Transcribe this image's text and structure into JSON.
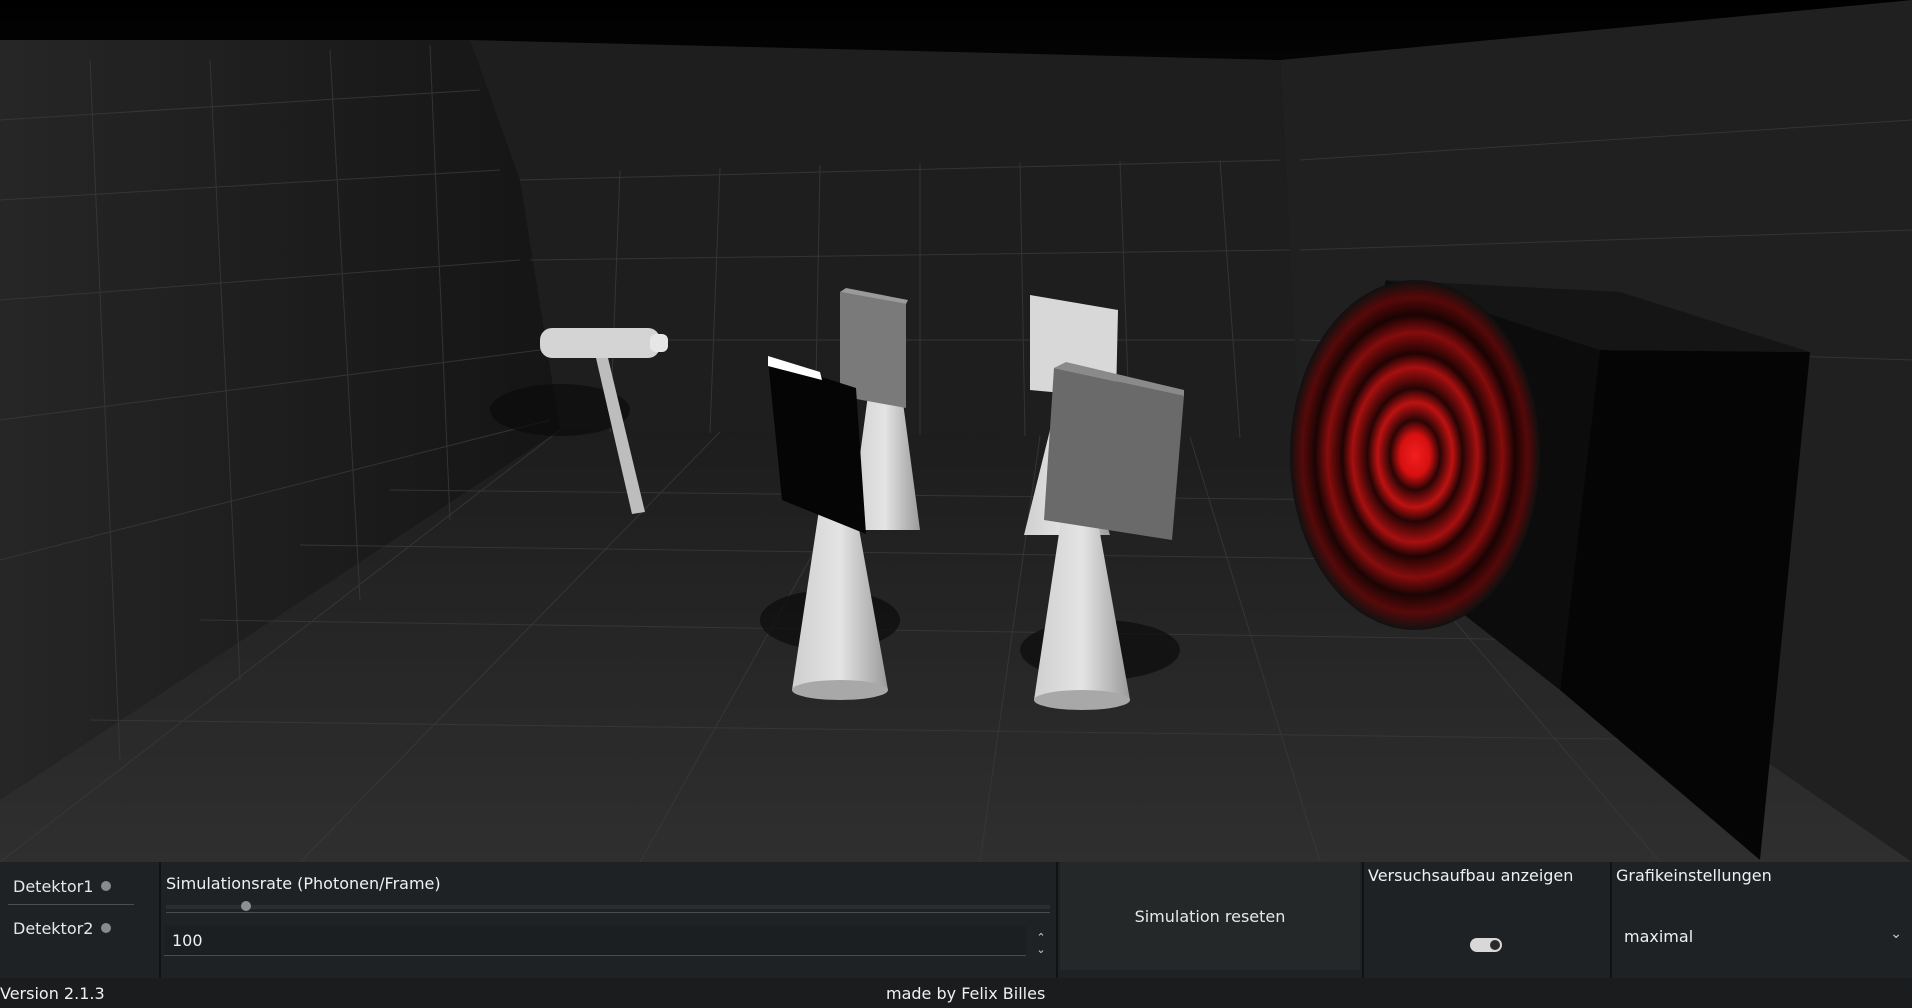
{
  "detectors": [
    {
      "label": "Detektor1"
    },
    {
      "label": "Detektor2"
    }
  ],
  "simulation_rate": {
    "title": "Simulationsrate (Photonen/Frame)",
    "value": "100",
    "slider_fraction": 0.09
  },
  "reset_button": {
    "label": "Simulation reseten"
  },
  "setup": {
    "title": "Versuchsaufbau anzeigen",
    "enabled": true
  },
  "graphics": {
    "title": "Grafikeinstellungen",
    "selected": "maximal"
  },
  "footer": {
    "version": "Version 2.1.3",
    "credit": "made by Felix Billes"
  },
  "colors": {
    "interference": "#ff1a1a",
    "panel": "#1f2224"
  }
}
